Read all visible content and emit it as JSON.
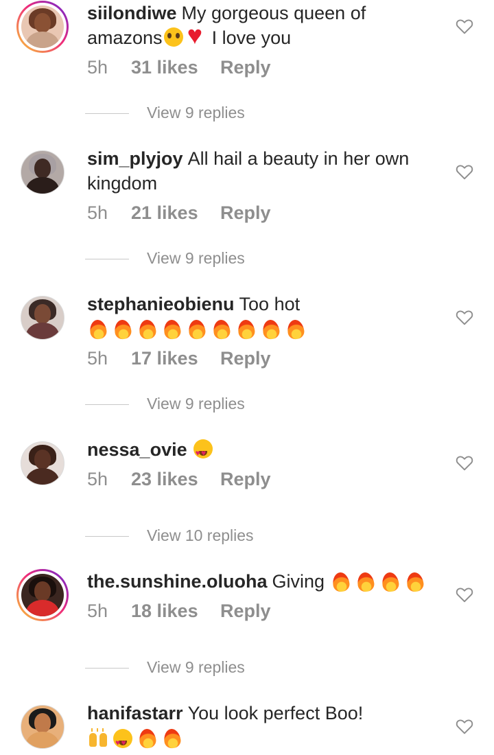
{
  "comments": [
    {
      "username": "siilondiwe",
      "text_line1": "My gorgeous queen of",
      "text_line2_pre": "amazons",
      "text_line2_post": "I love you",
      "emojis_line2": [
        "pleading-face-icon",
        "red-heart-icon"
      ],
      "time": "5h",
      "likes": "31 likes",
      "reply": "Reply",
      "view_replies": "View 9 replies",
      "avatar_story_ring": true,
      "avatar_colors": {
        "bg": "#e9c7b3",
        "hair": "#6b3b26",
        "skin": "#8a5134",
        "body": "#c9a38a"
      }
    },
    {
      "username": "sim_plyjoy",
      "text_line1": "All hail a beauty in her own",
      "text_line2_pre": "kingdom",
      "time": "5h",
      "likes": "21 likes",
      "reply": "Reply",
      "view_replies": "View 9 replies",
      "avatar_story_ring": false,
      "avatar_colors": {
        "bg": "#b3a9a6",
        "hair": "#a8a0a3",
        "skin": "#3f2a24",
        "body": "#2a1d1a"
      }
    },
    {
      "username": "stephanieobienu",
      "text_line1": "Too hot",
      "emojis_line2": [
        "fire-icon",
        "fire-icon",
        "fire-icon",
        "fire-icon",
        "fire-icon",
        "fire-icon",
        "fire-icon",
        "fire-icon",
        "fire-icon"
      ],
      "time": "5h",
      "likes": "17 likes",
      "reply": "Reply",
      "view_replies": "View 9 replies",
      "avatar_story_ring": false,
      "avatar_colors": {
        "bg": "#d8cdc8",
        "hair": "#3b2a26",
        "skin": "#7a4a36",
        "body": "#6a3b3b"
      }
    },
    {
      "username": "nessa_ovie",
      "emojis_line1": [
        "heart-eyes-icon"
      ],
      "time": "5h",
      "likes": "23 likes",
      "reply": "Reply",
      "view_replies": "View 10 replies",
      "avatar_story_ring": false,
      "avatar_colors": {
        "bg": "#e6ddd9",
        "hair": "#3a2118",
        "skin": "#5a3325",
        "body": "#4a2a20"
      }
    },
    {
      "username": "the.sunshine.oluoha",
      "text_line1": "Giving",
      "emojis_line1": [
        "fire-icon",
        "fire-icon",
        "fire-icon",
        "fire-icon"
      ],
      "time": "5h",
      "likes": "18 likes",
      "reply": "Reply",
      "view_replies": "View 9 replies",
      "avatar_story_ring": true,
      "avatar_colors": {
        "bg": "#3b2620",
        "hair": "#1a0f0c",
        "skin": "#6a3a26",
        "body": "#d92b2b"
      }
    },
    {
      "username": "hanifastarr",
      "text_line1": "You look perfect Boo!",
      "emojis_line2": [
        "raised-hands-icon",
        "heart-eyes-icon",
        "fire-icon",
        "fire-icon"
      ],
      "avatar_story_ring": false,
      "avatar_colors": {
        "bg": "#e8b07a",
        "hair": "#1b1b1b",
        "skin": "#c07a4a",
        "body": "#e0a060"
      }
    }
  ],
  "colors": {
    "text": "#262626",
    "muted": "#8e8e8e",
    "divider": "#c7c7c7"
  }
}
